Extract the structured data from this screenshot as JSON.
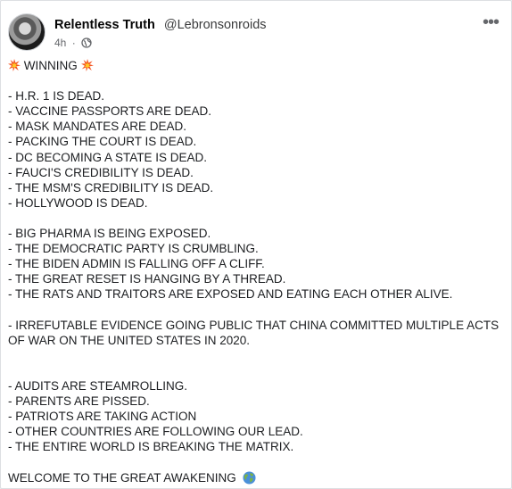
{
  "post": {
    "author_name": "Relentless Truth",
    "author_handle": "@Lebronsonroids",
    "timestamp": "4h",
    "separator": "·",
    "privacy_icon": "globe-icon",
    "more_label": "•••",
    "headline": "WINNING",
    "headline_icon": "collision-emoji",
    "group1": [
      "- H.R. 1 IS DEAD.",
      "- VACCINE PASSPORTS ARE DEAD.",
      "- MASK MANDATES ARE DEAD.",
      "- PACKING THE COURT IS DEAD.",
      "- DC BECOMING A STATE IS DEAD.",
      "- FAUCI'S CREDIBILITY IS DEAD.",
      "- THE MSM'S CREDIBILITY IS DEAD.",
      "- HOLLYWOOD IS DEAD."
    ],
    "group2": [
      "- BIG PHARMA IS BEING EXPOSED.",
      "- THE DEMOCRATIC PARTY IS CRUMBLING.",
      "- THE BIDEN ADMIN IS FALLING OFF A CLIFF.",
      "- THE GREAT RESET IS HANGING BY A THREAD.",
      "- THE RATS AND TRAITORS ARE EXPOSED AND EATING EACH OTHER ALIVE."
    ],
    "group3": "- IRREFUTABLE EVIDENCE GOING PUBLIC THAT CHINA COMMITTED MULTIPLE ACTS OF WAR ON THE UNITED STATES IN 2020.",
    "group4": [
      "- AUDITS ARE STEAMROLLING.",
      "- PARENTS ARE PISSED.",
      "- PATRIOTS ARE TAKING ACTION",
      "- OTHER COUNTRIES ARE FOLLOWING OUR LEAD.",
      "- THE ENTIRE WORLD IS BREAKING THE MATRIX."
    ],
    "closing": "WELCOME TO THE GREAT AWAKENING",
    "closing_icon": "earth-globe-emoji"
  },
  "colors": {
    "text_primary": "#050505",
    "text_secondary": "#65676b",
    "card_background": "#ffffff",
    "page_background": "#f0f2f5"
  }
}
